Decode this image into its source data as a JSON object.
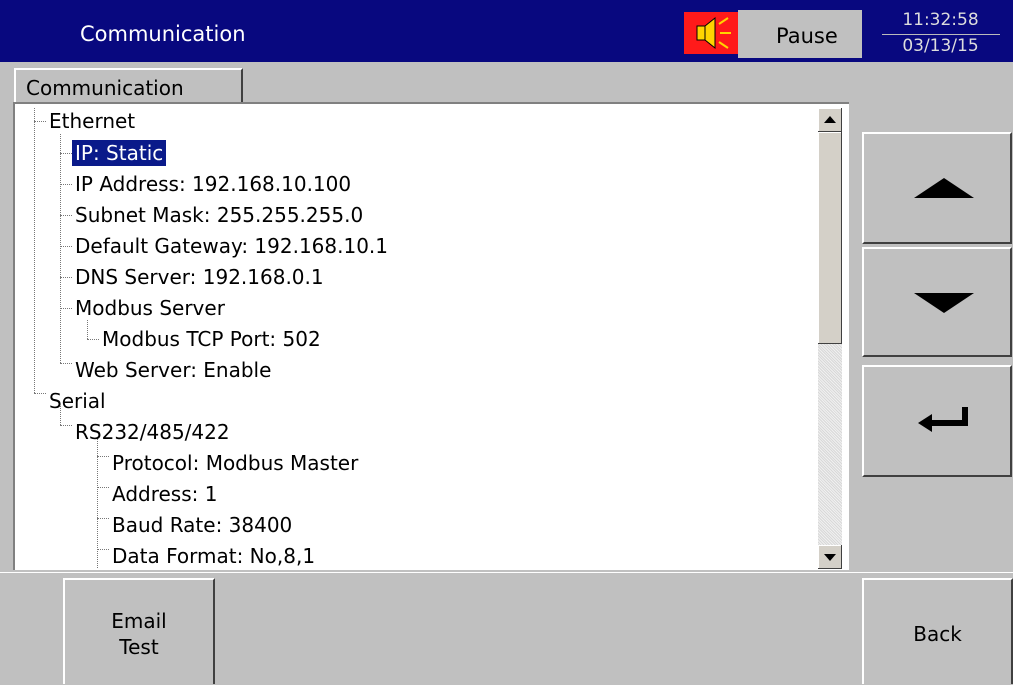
{
  "title": "Communication",
  "status": {
    "pause_label": "Pause"
  },
  "clock": {
    "time": "11:32:58",
    "date": "03/13/15"
  },
  "tab": {
    "label": "Communication"
  },
  "tree": {
    "ethernet": "Ethernet",
    "ip": "IP: Static",
    "ip_address": "IP Address: 192.168.10.100",
    "subnet": "Subnet Mask: 255.255.255.0",
    "gateway": "Default Gateway: 192.168.10.1",
    "dns": "DNS Server: 192.168.0.1",
    "modbus_server": "Modbus Server",
    "modbus_port": "Modbus TCP Port: 502",
    "web_server": "Web Server: Enable",
    "serial": "Serial",
    "rs232": "RS232/485/422",
    "protocol": "Protocol: Modbus Master",
    "address": "Address: 1",
    "baud": "Baud Rate: 38400",
    "data_format": "Data Format: No,8,1"
  },
  "buttons": {
    "email_test_line1": "Email",
    "email_test_line2": "Test",
    "back": "Back"
  },
  "colors": {
    "titlebar": "#08087f",
    "selection": "#0a1a8a",
    "alarm": "#ff1a1a"
  }
}
